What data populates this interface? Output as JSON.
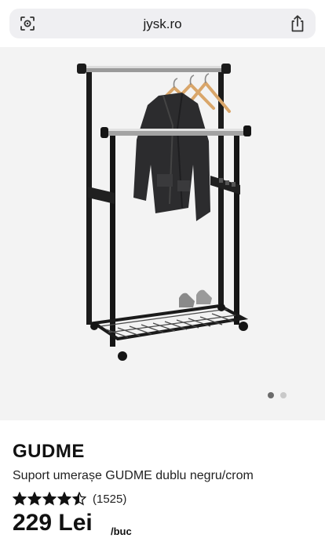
{
  "browser": {
    "url": "jysk.ro",
    "lens_icon": "camera-search-icon",
    "share_icon": "share-icon"
  },
  "gallery": {
    "image_alt": "Suport umerașe GUDME dublu negru/crom",
    "total_slides": 2,
    "active_slide": 1
  },
  "product": {
    "brand": "GUDME",
    "name": "Suport umerașe GUDME dublu negru/crom",
    "rating_value": 4.5,
    "rating_max": 5,
    "rating_count": "(1525)",
    "price": "229 Lei",
    "unit": "/buc"
  },
  "colors": {
    "gallery_bg": "#f3f3f3",
    "url_pill": "#efeff2",
    "text": "#111111"
  }
}
